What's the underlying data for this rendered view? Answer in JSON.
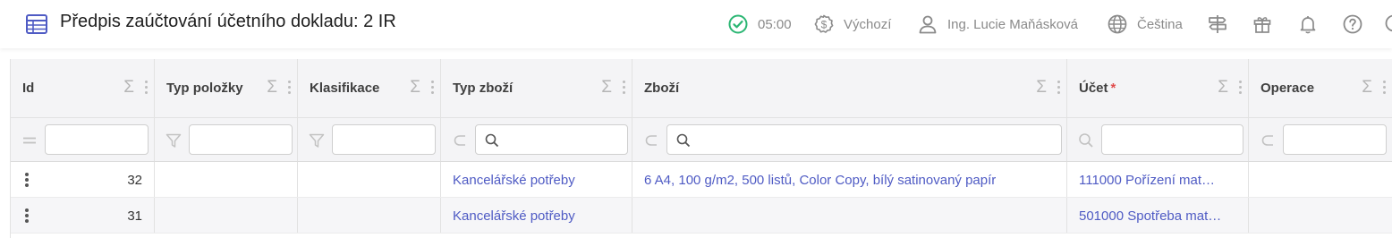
{
  "header": {
    "title": "Předpis zaúčtování účetního dokladu: 2 IR",
    "timer": "05:00",
    "currency_profile": "Výchozí",
    "user_name": "Ing. Lucie Maňásková",
    "language": "Čeština",
    "accent_color": "#4f5bc4",
    "status_color": "#2bb673"
  },
  "grid": {
    "columns": [
      {
        "label": "Id",
        "filter_icon": "equals-icon",
        "required": false
      },
      {
        "label": "Typ položky",
        "filter_icon": "funnel-icon",
        "required": false
      },
      {
        "label": "Klasifikace",
        "filter_icon": "funnel-icon",
        "required": false
      },
      {
        "label": "Typ zboží",
        "filter_icon": "subset-icon",
        "required": false
      },
      {
        "label": "Zboží",
        "filter_icon": "subset-icon",
        "required": false
      },
      {
        "label": "Účet",
        "required_mark": "*",
        "filter_icon": "search-icon",
        "required": true
      },
      {
        "label": "Operace",
        "filter_icon": "subset-icon",
        "required": false
      }
    ],
    "sum_symbol": "Σ",
    "rows": [
      {
        "id": "32",
        "typ_polozky": "",
        "klasifikace": "",
        "typ_zbozi": "Kancelářské potřeby",
        "zbozi": "6 A4, 100 g/m2, 500 listů, Color Copy, bílý satinovaný papír",
        "ucet": "111000 Pořízení mat…",
        "operace": ""
      },
      {
        "id": "31",
        "typ_polozky": "",
        "klasifikace": "",
        "typ_zbozi": "Kancelářské potřeby",
        "zbozi": "",
        "ucet": "501000 Spotřeba mat…",
        "operace": ""
      }
    ]
  }
}
